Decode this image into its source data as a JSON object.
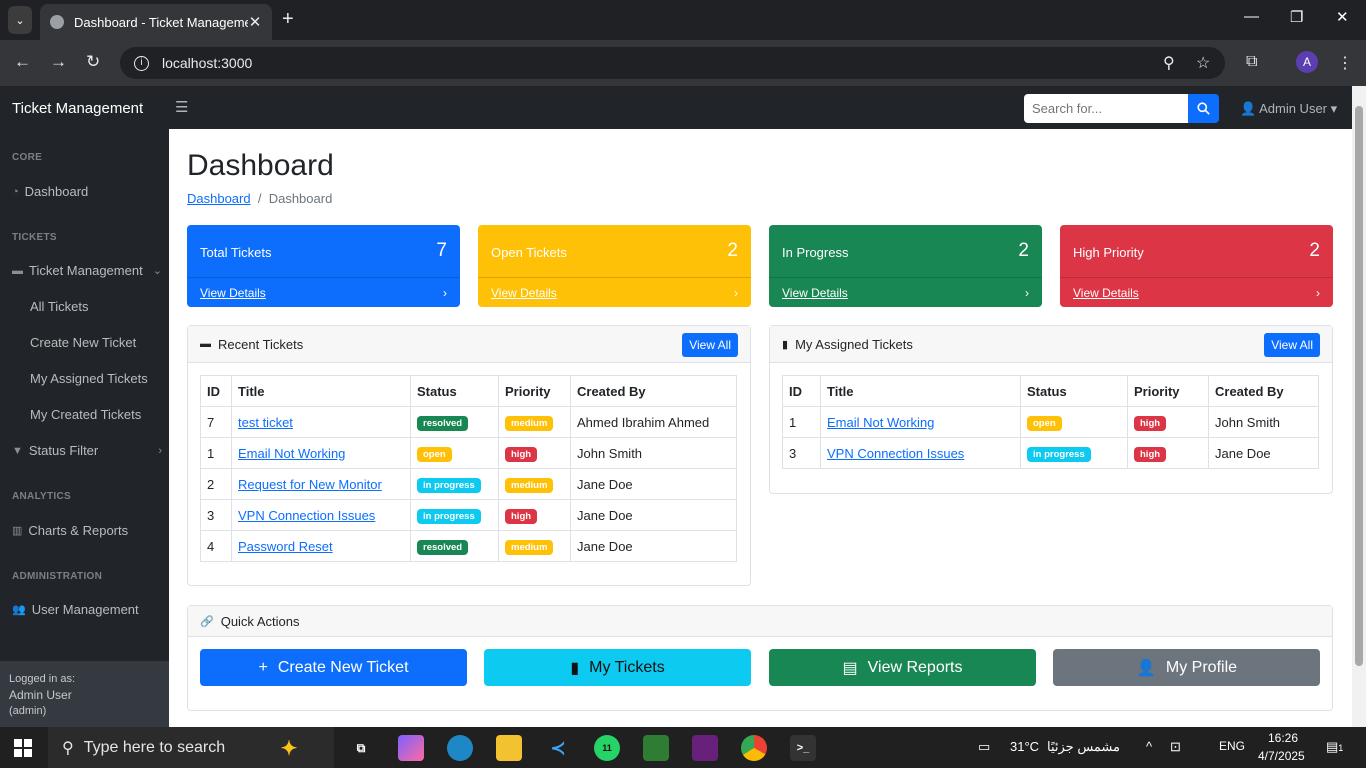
{
  "browser": {
    "tab_title": "Dashboard - Ticket Managemen",
    "url": "localhost:3000",
    "avatar_letter": "A"
  },
  "topnav": {
    "brand": "Ticket Management",
    "search_placeholder": "Search for...",
    "user": "Admin User"
  },
  "sidebar": {
    "core_head": "CORE",
    "dashboard": "Dashboard",
    "tickets_head": "TICKETS",
    "ticket_mgmt": "Ticket Management",
    "all_tickets": "All Tickets",
    "create_ticket": "Create New Ticket",
    "my_assigned": "My Assigned Tickets",
    "my_created": "My Created Tickets",
    "status_filter": "Status Filter",
    "analytics_head": "ANALYTICS",
    "charts": "Charts & Reports",
    "admin_head": "ADMINISTRATION",
    "user_mgmt": "User Management",
    "footer_label": "Logged in as:",
    "footer_user": "Admin User",
    "footer_role": "(admin)"
  },
  "page": {
    "title": "Dashboard",
    "crumb_link": "Dashboard",
    "crumb_sep": "/",
    "crumb_current": "Dashboard"
  },
  "stats": [
    {
      "label": "Total Tickets",
      "value": "7",
      "link": "View Details",
      "color": "#0d6efd"
    },
    {
      "label": "Open Tickets",
      "value": "2",
      "link": "View Details",
      "color": "#ffc107"
    },
    {
      "label": "In Progress",
      "value": "2",
      "link": "View Details",
      "color": "#198754"
    },
    {
      "label": "High Priority",
      "value": "2",
      "link": "View Details",
      "color": "#dc3545"
    }
  ],
  "recent": {
    "title": "Recent Tickets",
    "view_all": "View All",
    "headers": [
      "ID",
      "Title",
      "Status",
      "Priority",
      "Created By"
    ],
    "rows": [
      {
        "id": "7",
        "title": "test ticket",
        "status": "resolved",
        "priority": "medium",
        "by": "Ahmed Ibrahim Ahmed"
      },
      {
        "id": "1",
        "title": "Email Not Working",
        "status": "open",
        "priority": "high",
        "by": "John Smith"
      },
      {
        "id": "2",
        "title": "Request for New Monitor",
        "status": "in progress",
        "priority": "medium",
        "by": "Jane Doe"
      },
      {
        "id": "3",
        "title": "VPN Connection Issues",
        "status": "in progress",
        "priority": "high",
        "by": "Jane Doe"
      },
      {
        "id": "4",
        "title": "Password Reset",
        "status": "resolved",
        "priority": "medium",
        "by": "Jane Doe"
      }
    ]
  },
  "assigned": {
    "title": "My Assigned Tickets",
    "view_all": "View All",
    "headers": [
      "ID",
      "Title",
      "Status",
      "Priority",
      "Created By"
    ],
    "rows": [
      {
        "id": "1",
        "title": "Email Not Working",
        "status": "open",
        "priority": "high",
        "by": "John Smith"
      },
      {
        "id": "3",
        "title": "VPN Connection Issues",
        "status": "in progress",
        "priority": "high",
        "by": "Jane Doe"
      }
    ]
  },
  "quick": {
    "title": "Quick Actions",
    "create": "Create New Ticket",
    "mine": "My Tickets",
    "reports": "View Reports",
    "profile": "My Profile"
  },
  "taskbar": {
    "search": "Type here to search",
    "weather": "31°C",
    "weather_text": "مشمس جزئيًا",
    "lang": "ENG",
    "time": "16:26",
    "date": "4/7/2025",
    "notif": "1",
    "whatsapp_count": "11"
  }
}
